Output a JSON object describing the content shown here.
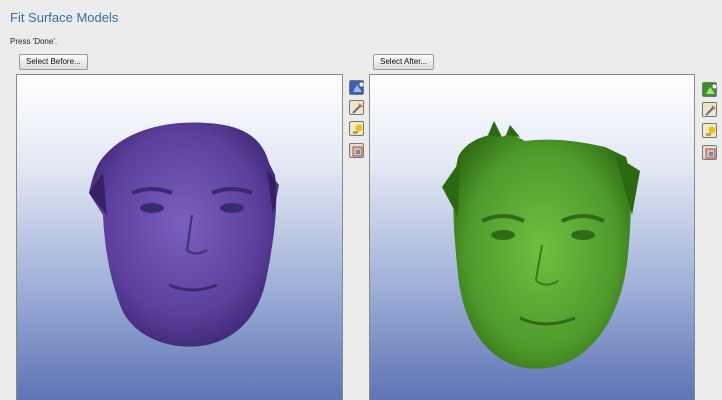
{
  "panel": {
    "title": "Fit Surface Models",
    "instruction": "Press 'Done'."
  },
  "before": {
    "button_label": "Select Before...",
    "mesh_color": "#5a3e9a",
    "tools": [
      "model-color-icon",
      "draw-icon",
      "landmark-icon",
      "face-view-icon"
    ]
  },
  "after": {
    "button_label": "Select After...",
    "mesh_color": "#4f9a2c",
    "tools": [
      "model-color-icon",
      "draw-icon",
      "landmark-icon",
      "face-view-icon"
    ]
  },
  "colors": {
    "title": "#3a6ea5",
    "viewer_bottom": "#5e74b4"
  }
}
